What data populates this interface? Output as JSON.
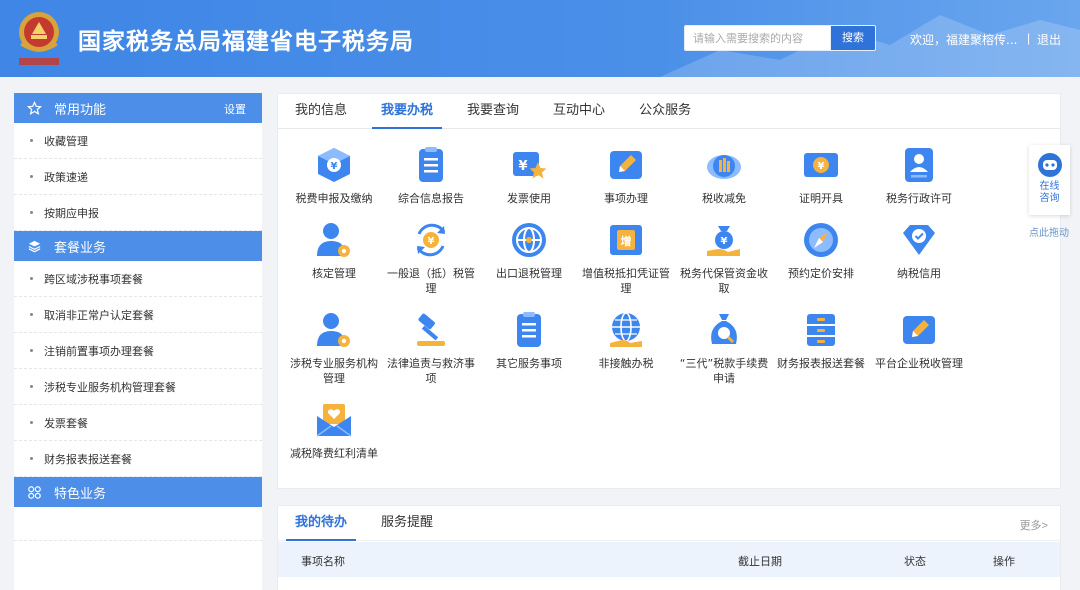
{
  "header": {
    "title": "国家税务总局福建省电子税务局",
    "search_placeholder": "请输入需要搜索的内容",
    "search_label": "搜索",
    "welcome": "欢迎，福建聚榕传...",
    "separator": "|",
    "logout": "退出"
  },
  "sidebar": {
    "sections": [
      {
        "title": "常用功能",
        "icon": "star-icon",
        "settings": "设置",
        "items": [
          "收藏管理",
          "政策速递",
          "按期应申报"
        ]
      },
      {
        "title": "套餐业务",
        "icon": "layers-icon",
        "items": [
          "跨区域涉税事项套餐",
          "取消非正常户认定套餐",
          "注销前置事项办理套餐",
          "涉税专业服务机构管理套餐",
          "发票套餐",
          "财务报表报送套餐"
        ]
      },
      {
        "title": "特色业务",
        "icon": "grid-icon",
        "items": []
      }
    ]
  },
  "main": {
    "tabs": [
      "我的信息",
      "我要办税",
      "我要查询",
      "互动中心",
      "公众服务"
    ],
    "active_tab": 1,
    "services": [
      {
        "label": "税费申报及缴纳",
        "icon": "tax-box-icon"
      },
      {
        "label": "综合信息报告",
        "icon": "document-icon"
      },
      {
        "label": "发票使用",
        "icon": "invoice-star-icon"
      },
      {
        "label": "事项办理",
        "icon": "pencil-card-icon"
      },
      {
        "label": "税收减免",
        "icon": "coin-bag-icon"
      },
      {
        "label": "证明开具",
        "icon": "yuan-ticket-icon"
      },
      {
        "label": "税务行政许可",
        "icon": "id-card-icon"
      },
      {
        "label": "核定管理",
        "icon": "user-gear-icon"
      },
      {
        "label": "一般退（抵）税管理",
        "icon": "yuan-refresh-icon"
      },
      {
        "label": "出口退税管理",
        "icon": "globe-icon"
      },
      {
        "label": "增值税抵扣凭证管理",
        "icon": "vat-ticket-icon"
      },
      {
        "label": "税务代保管资金收取",
        "icon": "money-hand-icon"
      },
      {
        "label": "预约定价安排",
        "icon": "compass-icon"
      },
      {
        "label": "纳税信用",
        "icon": "diamond-check-icon"
      },
      {
        "label": "涉税专业服务机构管理",
        "icon": "user-gear-icon"
      },
      {
        "label": "法律追责与救济事项",
        "icon": "gavel-icon"
      },
      {
        "label": "其它服务事项",
        "icon": "document-icon"
      },
      {
        "label": "非接触办税",
        "icon": "globe-hand-icon"
      },
      {
        "label": "“三代”税款手续费申请",
        "icon": "money-bag-search-icon"
      },
      {
        "label": "财务报表报送套餐",
        "icon": "cabinet-icon"
      },
      {
        "label": "平台企业税收管理",
        "icon": "pencil-card-icon"
      },
      {
        "label": "减税降费红利清单",
        "icon": "heart-envelope-icon"
      }
    ]
  },
  "todo": {
    "tabs": [
      "我的待办",
      "服务提醒"
    ],
    "active_tab": 0,
    "more": "更多>",
    "columns": [
      "事项名称",
      "截止日期",
      "状态",
      "操作"
    ]
  },
  "float_widget": {
    "label_line1": "在线",
    "label_line2": "咨询",
    "drag_hint": "点此拖动"
  },
  "colors": {
    "primary": "#2f73d9",
    "header": "#4a8fe8",
    "sidebar_head": "#4c8ee8"
  }
}
